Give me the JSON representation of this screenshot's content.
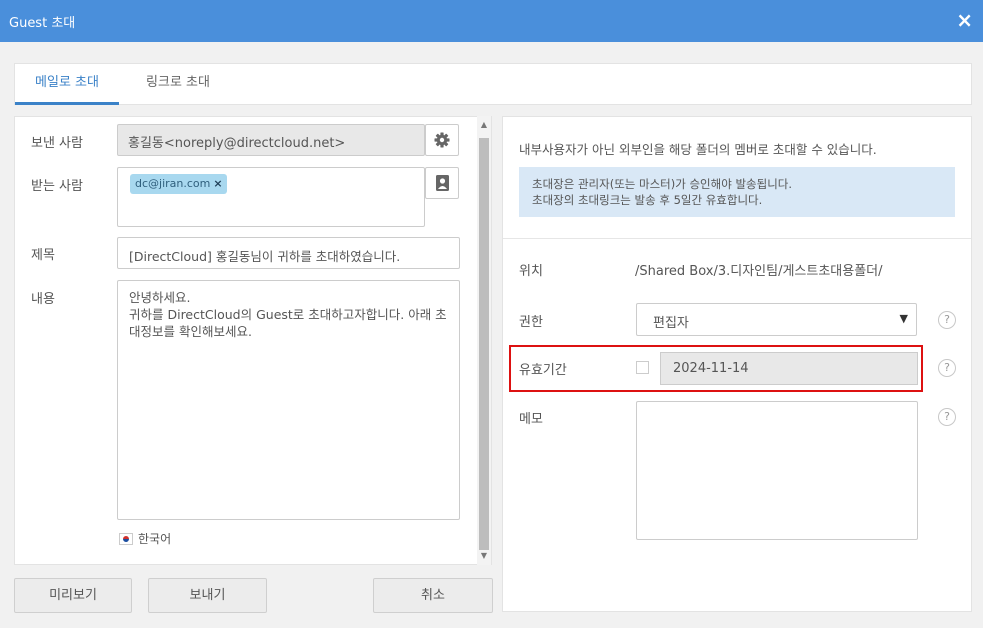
{
  "window": {
    "title": "Guest 초대",
    "close_label": "×"
  },
  "tabs": [
    {
      "label": "메일로 초대",
      "active": true
    },
    {
      "label": "링크로 초대",
      "active": false
    }
  ],
  "form": {
    "sender_label": "보낸 사람",
    "sender_value": "홍길동<noreply@directcloud.net>",
    "recipient_label": "받는 사람",
    "recipients": [
      {
        "email": "dc@jiran.com",
        "remove": "×"
      }
    ],
    "subject_label": "제목",
    "subject_value": "[DirectCloud] 홍길동님이 귀하를 초대하였습니다.",
    "body_label": "내용",
    "body_value": "안녕하세요.\n귀하를 DirectCloud의 Guest로 초대하고자합니다. 아래 초\n대정보를 확인해보세요.",
    "language": "한국어"
  },
  "buttons": {
    "preview": "미리보기",
    "send": "보내기",
    "cancel": "취소"
  },
  "info": {
    "description": "내부사용자가 아닌 외부인을 해당 폴더의 멤버로 초대할 수 있습니다.",
    "notice_line1": "초대장은 관리자(또는 마스터)가 승인해야 발송됩니다.",
    "notice_line2": "초대장의 초대링크는 발송 후 5일간 유효합니다.",
    "location_label": "위치",
    "location_value": "/Shared Box/3.디자인팀/게스트초대용폴더/",
    "permission_label": "권한",
    "permission_value": "편집자",
    "validity_label": "유효기간",
    "validity_checked": false,
    "validity_date": "2024-11-14",
    "memo_label": "메모",
    "memo_value": ""
  },
  "colors": {
    "titlebar": "#4a8fdb",
    "accent": "#3b82c8",
    "highlight_border": "#dd1111",
    "notice_bg": "#d9e8f6",
    "chip_bg": "#a8d8ef"
  }
}
